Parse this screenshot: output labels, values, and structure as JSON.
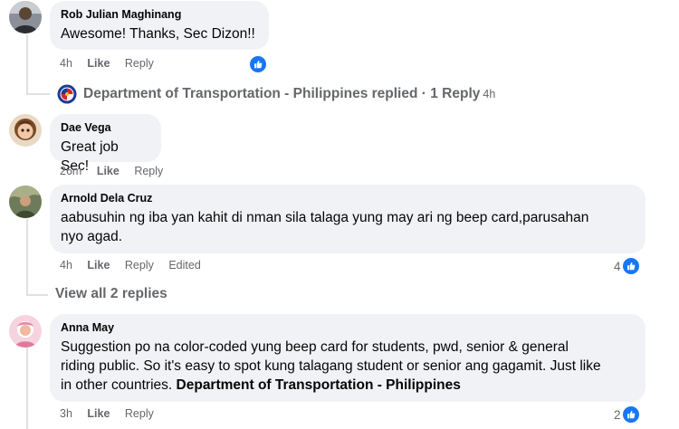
{
  "comments": [
    {
      "author": "Rob Julian Maghinang",
      "lines": [
        "Awesome! Thanks, Sec Dizon!!"
      ],
      "time": "4h",
      "like": "Like",
      "reply": "Reply",
      "reaction_count": ""
    },
    {
      "author": "Dae Vega",
      "lines": [
        "Great job Sec!"
      ],
      "time": "26m",
      "like": "Like",
      "reply": "Reply"
    },
    {
      "author": "Arnold Dela Cruz",
      "lines": [
        "aabusuhin ng iba yan kahit di nman sila talaga yung may ari ng beep card,parusahan",
        "nyo agad."
      ],
      "time": "4h",
      "like": "Like",
      "reply": "Reply",
      "edited": "Edited",
      "reaction_count": "4"
    },
    {
      "author": "Anna May",
      "lines": [
        "Suggestion po na color-coded yung beep card for students, pwd, senior & general",
        "riding public. So it's easy to spot kung talagang student or senior ang gagamit. Just like",
        "in other countries."
      ],
      "mention": "Department of Transportation - Philippines",
      "time": "3h",
      "like": "Like",
      "reply": "Reply",
      "reaction_count": "2"
    }
  ],
  "dotr_reply": {
    "text": "Department of Transportation - Philippines replied · 1 Reply",
    "time": "4h"
  },
  "view_all_replies": "View all 2 replies",
  "colors": {
    "bubble": "#f0f2f5",
    "meta": "#65676b",
    "like_blue": "#1877f2",
    "rail": "#dfe1e5"
  },
  "icons": {
    "like": "thumbs-up-icon",
    "dotr": "dotr-logo-icon"
  }
}
